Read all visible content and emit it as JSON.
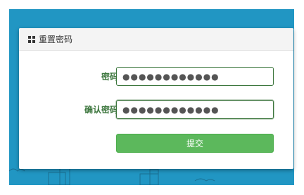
{
  "panel": {
    "title": "重置密码",
    "title_icon": "grid-icon"
  },
  "form": {
    "password": {
      "label": "密码",
      "value": "●●●●●●●●●●●●"
    },
    "confirm_password": {
      "label": "确认密码",
      "value": "●●●●●●●●●●●●"
    },
    "submit_label": "提交"
  },
  "colors": {
    "backdrop": "#2196c3",
    "label_green": "#3c763d",
    "button_green": "#5cb85c"
  }
}
